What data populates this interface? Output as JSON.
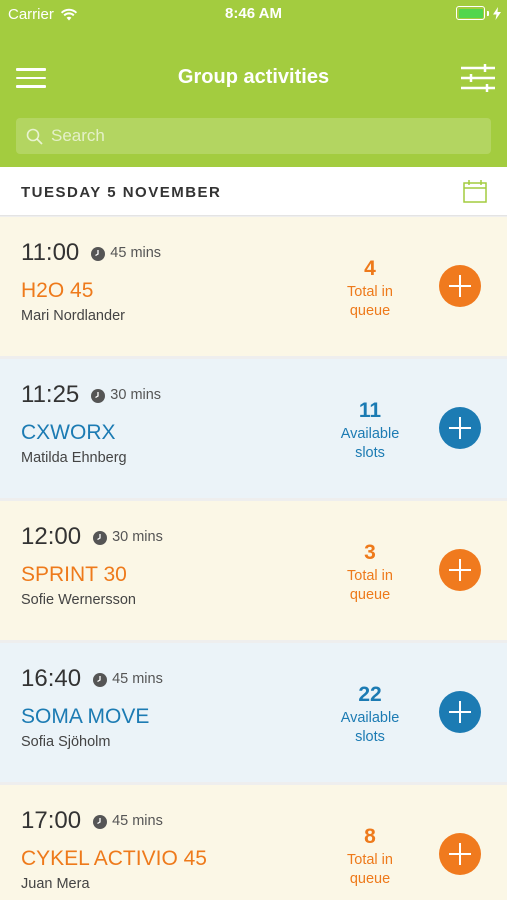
{
  "status": {
    "carrier": "Carrier",
    "time": "8:46 AM"
  },
  "header": {
    "title": "Group activities"
  },
  "search": {
    "placeholder": "Search"
  },
  "date": {
    "label": "TUESDAY 5 NOVEMBER"
  },
  "colors": {
    "header_green": "#a3cc3f",
    "queue_orange": "#ee7a1b",
    "slots_blue": "#1c7bb3",
    "queue_bg": "#fbf7e6",
    "slots_bg": "#ebf3f8"
  },
  "activities": [
    {
      "time": "11:00",
      "duration": "45 mins",
      "name": "H2O 45",
      "instructor": "Mari Nordlander",
      "count": "4",
      "count_label": "Total in queue",
      "kind": "queue"
    },
    {
      "time": "11:25",
      "duration": "30 mins",
      "name": "CXWORX",
      "instructor": "Matilda Ehnberg",
      "count": "11",
      "count_label": "Available slots",
      "kind": "slots"
    },
    {
      "time": "12:00",
      "duration": "30 mins",
      "name": "SPRINT 30",
      "instructor": "Sofie Wernersson",
      "count": "3",
      "count_label": "Total in queue",
      "kind": "queue"
    },
    {
      "time": "16:40",
      "duration": "45 mins",
      "name": "SOMA MOVE",
      "instructor": "Sofia Sjöholm",
      "count": "22",
      "count_label": "Available slots",
      "kind": "slots"
    },
    {
      "time": "17:00",
      "duration": "45 mins",
      "name": "CYKEL ACTIVIO 45",
      "instructor": "Juan Mera",
      "count": "8",
      "count_label": "Total in queue",
      "kind": "queue"
    }
  ],
  "icons": {
    "menu": "hamburger-icon",
    "filter": "sliders-icon",
    "search": "search-icon",
    "calendar": "calendar-icon",
    "clock": "clock-icon",
    "add": "plus-icon"
  }
}
